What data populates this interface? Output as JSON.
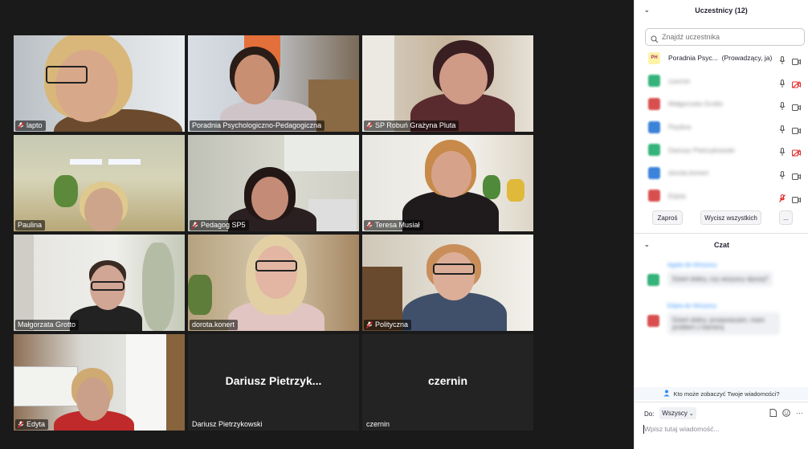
{
  "participants_panel": {
    "title": "Uczestnicy (12)",
    "search_placeholder": "Znajdź uczestnika",
    "host": {
      "name": "Poradnia Psyc...",
      "role": "(Prowadzący, ja)",
      "avatar_text": "PH"
    },
    "blurred_rows": [
      {
        "name": "czernin",
        "color": "#34b37a",
        "mic": "on",
        "cam": "off"
      },
      {
        "name": "Małgorzata Grotto",
        "color": "#d94f4f",
        "mic": "on",
        "cam": "on"
      },
      {
        "name": "Paulina",
        "color": "#3b82d9",
        "mic": "on",
        "cam": "on"
      },
      {
        "name": "Dariusz Pietrzykowski",
        "color": "#34b37a",
        "mic": "on",
        "cam": "off"
      },
      {
        "name": "dorota.konert",
        "color": "#3b82d9",
        "mic": "on",
        "cam": "on"
      },
      {
        "name": "Edyta",
        "color": "#d94f4f",
        "mic": "muted",
        "cam": "on"
      }
    ],
    "invite_label": "Zaproś",
    "mute_all_label": "Wycisz wszystkich",
    "more_label": "..."
  },
  "chat": {
    "title": "Czat",
    "messages": [
      {
        "sender": "Agata",
        "to": "Wszyscy",
        "text": "Dzień dobry, czy wszyscy słyszą?",
        "avatar_color": "#34b37a"
      },
      {
        "sender": "Edyta",
        "to": "Wszyscy",
        "text": "Dzień dobry, przepraszam, mam problem z kamerą",
        "avatar_color": "#d94f4f"
      }
    ],
    "who_sees": "Kto może zobaczyć Twoje wiadomości?",
    "to_label": "Do:",
    "recipient": "Wszyscy",
    "input_placeholder": "Wpisz tutaj wiadomość..."
  },
  "video_tiles": [
    {
      "name": "lapto",
      "muted": true
    },
    {
      "name": "Poradnia Psychologiczno-Pedagogiczna",
      "muted": false
    },
    {
      "name": "SP Robuń Grażyna Pluta",
      "muted": true
    },
    {
      "name": "Paulina",
      "muted": false
    },
    {
      "name": "Pedagog SP5",
      "muted": true
    },
    {
      "name": "Teresa Musiał",
      "muted": true
    },
    {
      "name": "Małgorzata Grotto",
      "muted": false
    },
    {
      "name": "dorota.konert",
      "muted": false
    },
    {
      "name": "Polityczna",
      "muted": true
    },
    {
      "name": "Edyta",
      "muted": true
    },
    {
      "name": "Dariusz Pietrzykowski",
      "muted": false,
      "big": "Dariusz  Pietrzyk..."
    },
    {
      "name": "czernin",
      "muted": false,
      "big": "czernin"
    }
  ],
  "colors": {
    "active_speaker": "#c8d64a",
    "mute_red": "#e02828",
    "link_blue": "#2d8cff"
  }
}
